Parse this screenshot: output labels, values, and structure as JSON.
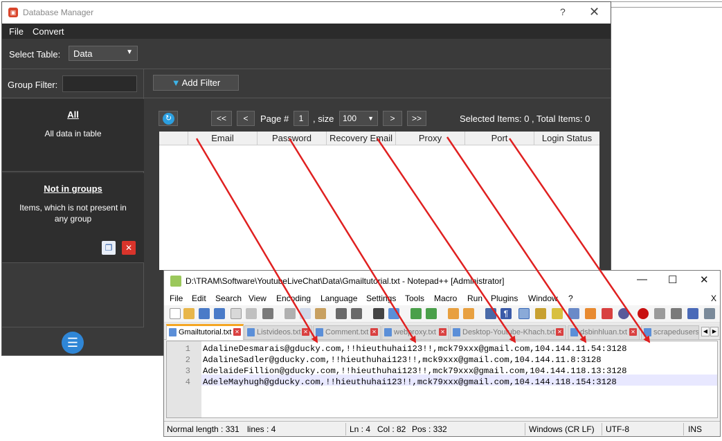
{
  "db": {
    "title": "Database Manager",
    "help": "?",
    "close": "✕",
    "menu": [
      "File",
      "Convert"
    ],
    "select_table_label": "Select Table:",
    "select_table_value": "Data",
    "group_filter_label": "Group Filter:",
    "groups": [
      {
        "title": "All",
        "desc": "All data in table"
      },
      {
        "title": "Not in groups",
        "desc": "Items, which is not present in any group"
      }
    ],
    "add_filter": "Add Filter",
    "pager": {
      "first": "<<",
      "prev": "<",
      "page_label": "Page #",
      "page_value": "1",
      "size_label": ", size",
      "size_value": "100",
      "next": ">",
      "last": ">>"
    },
    "selected_items": "Selected Items:  0  ,  Total Items:  0",
    "columns": [
      "",
      "Email",
      "Password",
      "Recovery Email",
      "Proxy",
      "Port",
      "Login Status"
    ]
  },
  "npp": {
    "title": "D:\\TRAM\\Software\\YoutubeLiveChat\\Data\\Gmailtutorial.txt - Notepad++ [Administrator]",
    "menu": [
      "File",
      "Edit",
      "Search",
      "View",
      "Encoding",
      "Language",
      "Settings",
      "Tools",
      "Macro",
      "Run",
      "Plugins",
      "Window",
      "?"
    ],
    "menu_close": "X",
    "tabs": [
      "Gmailtutorial.txt",
      "Listvideos.txt",
      "Comment.txt",
      "webproxy.txt",
      "Desktop-Youtube-Khach.txt",
      "dsbinhluan.txt",
      "scrapedusers"
    ],
    "lines": [
      {
        "num": "1",
        "text": "AdalineDesmarais@gducky.com,!!hieuthuhai123!!,mck79xxx@gmail.com,104.144.11.54:3128"
      },
      {
        "num": "2",
        "text": "AdalineSadler@gducky.com,!!hieuthuhai123!!,mck9xxx@gmail.com,104.144.11.8:3128"
      },
      {
        "num": "3",
        "text": "AdelaideFillion@gducky.com,!!hieuthuhai123!!,mck79xxx@gmail.com,104.144.118.13:3128"
      },
      {
        "num": "4",
        "text": "AdeleMayhugh@gducky.com,!!hieuthuhai123!!,mck79xxx@gmail.com,104.144.118.154:3128"
      }
    ],
    "status": {
      "length": "Normal length : 331",
      "lines": "lines : 4",
      "ln": "Ln : 4",
      "col": "Col : 82",
      "pos": "Pos : 332",
      "eol": "Windows (CR LF)",
      "encoding": "UTF-8",
      "mode": "INS"
    }
  },
  "colors": {
    "dark_bg": "#3a3a3a",
    "arrow": "#e02020",
    "accent_blue": "#2f86d6"
  }
}
